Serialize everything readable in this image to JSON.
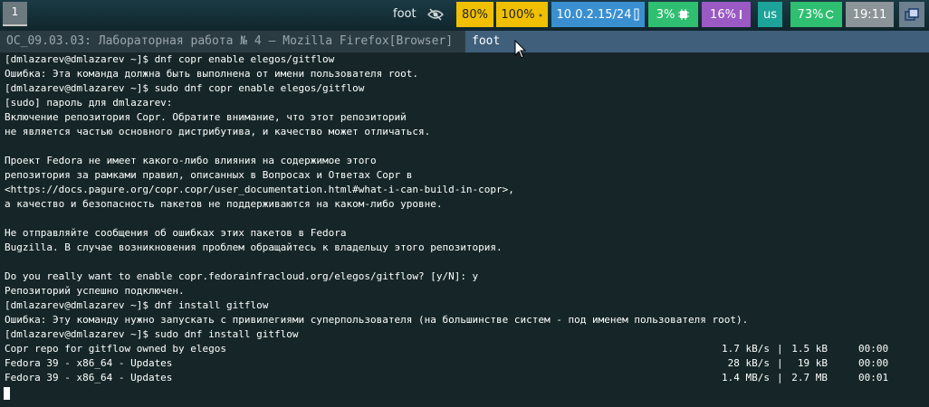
{
  "topbar": {
    "workspace": "1",
    "app_name": "foot",
    "cpu": "80%",
    "brightness": "100%",
    "ip": "10.0.2.15/24",
    "cpu2": "3%",
    "memory": "16%",
    "keyboard": "us",
    "battery": "73%",
    "clock": "19:11",
    "colors": {
      "yellow": "#f0c000",
      "blue": "#3a8fd0",
      "green": "#2fbf71",
      "purple": "#9b59c4",
      "teal": "#1ea39a",
      "grey": "#8b9498"
    }
  },
  "tabs": [
    {
      "label": "OC_09.03.03: Лабораторная работа № 4 — Mozilla Firefox[Browser]"
    },
    {
      "label": "foot"
    }
  ],
  "terminal": {
    "lines": [
      "[dmlazarev@dmlazarev ~]$ dnf copr enable elegos/gitflow",
      "Ошибка: Эта команда должна быть выполнена от имени пользователя root.",
      "[dmlazarev@dmlazarev ~]$ sudo dnf copr enable elegos/gitflow",
      "[sudo] пароль для dmlazarev:",
      "Включение репозитория Copr. Обратите внимание, что этот репозиторий",
      "не является частью основного дистрибутива, и качество может отличаться.",
      "",
      "Проект Fedora не имеет какого-либо влияния на содержимое этого",
      "репозитория за рамками правил, описанных в Вопросах и Ответах Copr в",
      "<https://docs.pagure.org/copr.copr/user_documentation.html#what-i-can-build-in-copr>,",
      "а качество и безопасность пакетов не поддерживаются на каком-либо уровне.",
      "",
      "Не отправляйте сообщения об ошибках этих пакетов в Fedora",
      "Bugzilla. В случае возникновения проблем обращайтесь к владельцу этого репозитория.",
      "",
      "Do you really want to enable copr.fedorainfracloud.org/elegos/gitflow? [y/N]: y",
      "Репозиторий успешно подключен.",
      "[dmlazarev@dmlazarev ~]$ dnf install gitflow",
      "Ошибка: Эту команду нужно запускать с привилегиями суперпользователя (на большинстве систем - под именем пользователя root).",
      "[dmlazarev@dmlazarev ~]$ sudo dnf install gitflow",
      "Copr repo for gitflow owned by elegos",
      "Fedora 39 - x86_64 - Updates",
      "Fedora 39 - x86_64 - Updates"
    ],
    "progress": [
      {
        "speed": "1.7 kB/s",
        "size": "1.5 kB",
        "time": "00:00"
      },
      {
        "speed": "28 kB/s",
        "size": " 19 kB",
        "time": "00:00"
      },
      {
        "speed": "1.4 MB/s",
        "size": "2.7 MB",
        "time": "00:01"
      }
    ]
  }
}
